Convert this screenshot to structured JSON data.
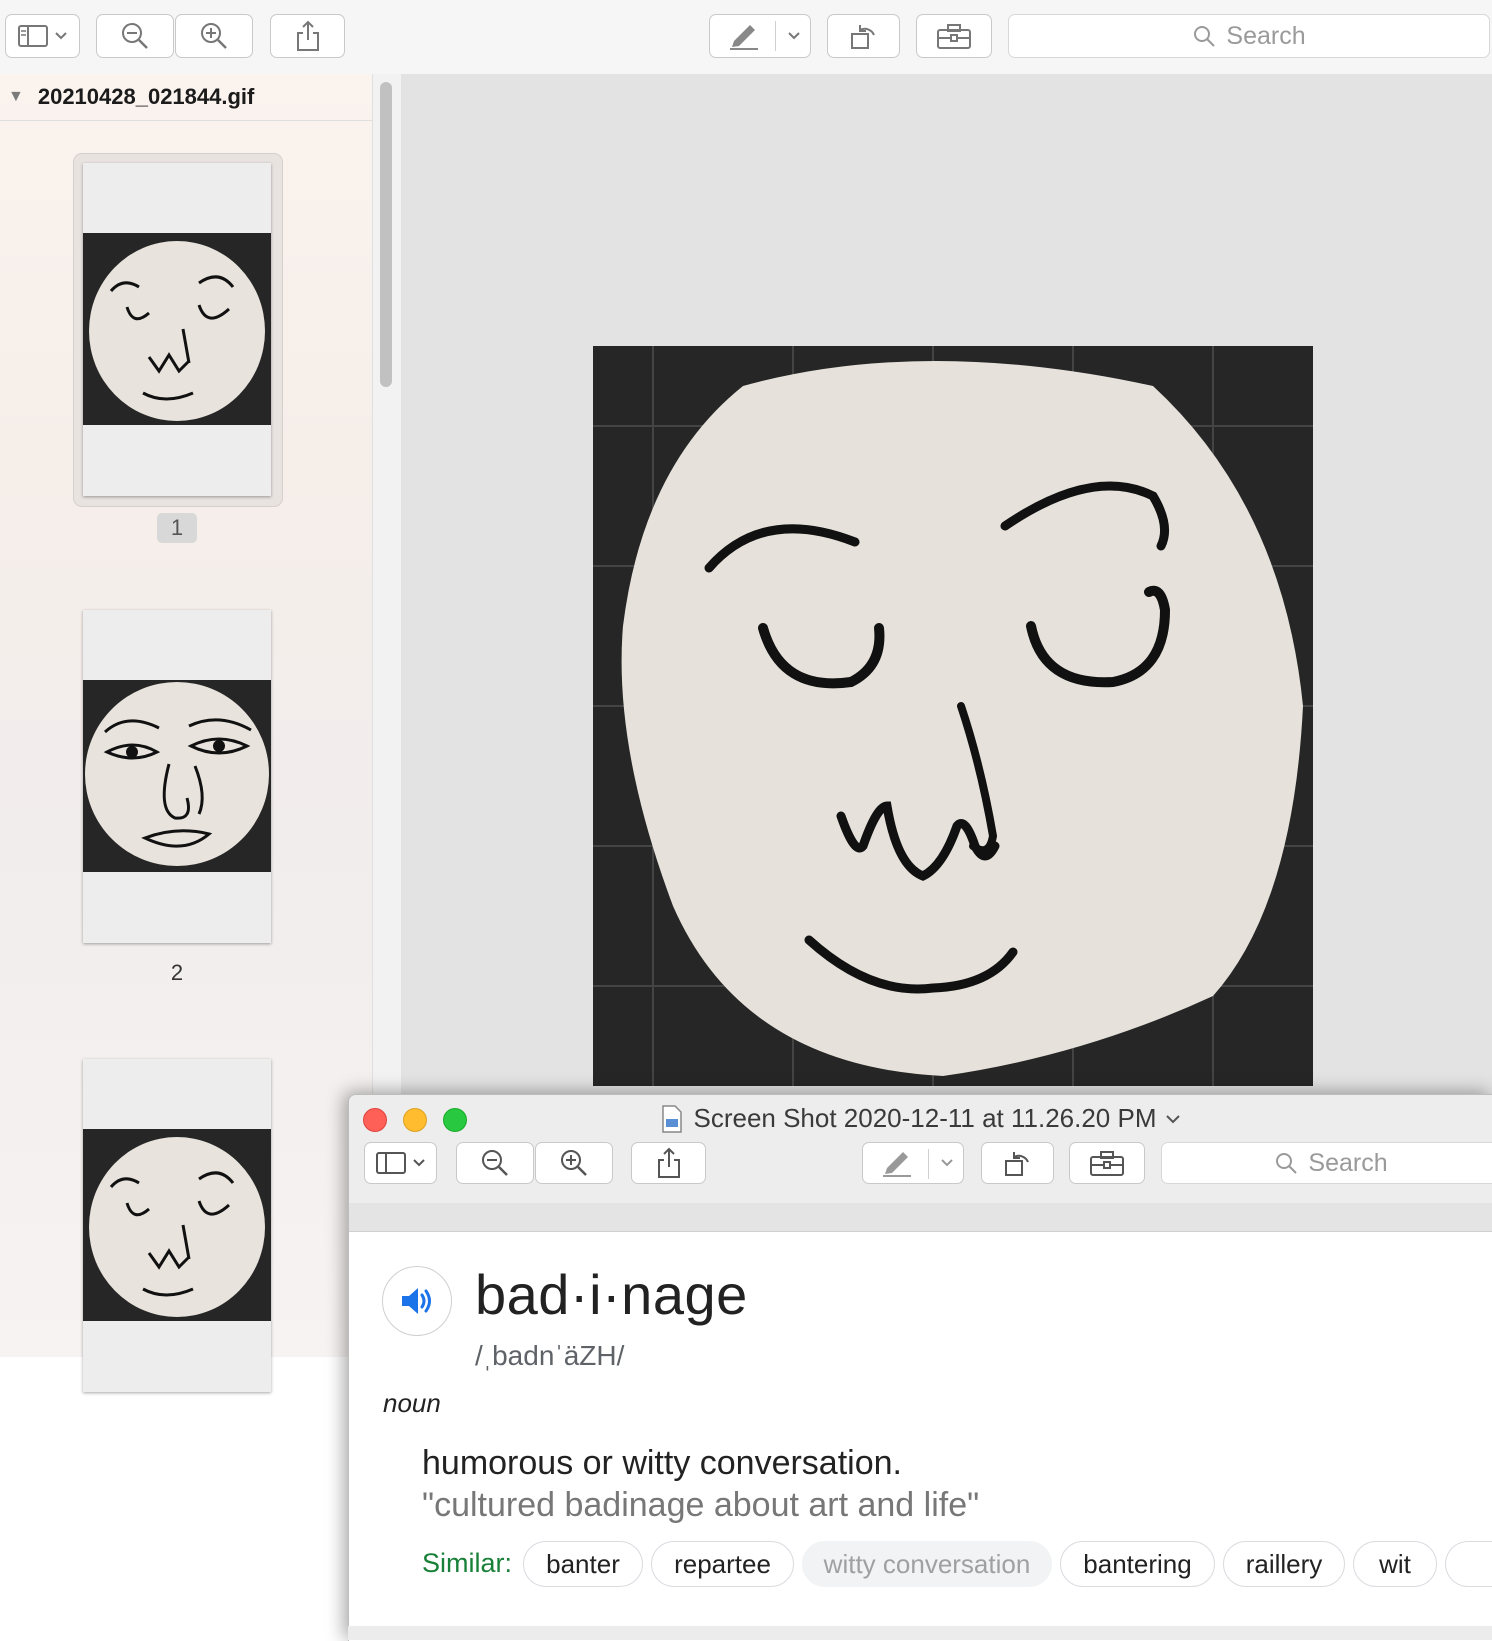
{
  "back_window": {
    "search_placeholder": "Search",
    "sidebar": {
      "file_name": "20210428_021844.gif",
      "pages": [
        {
          "label": "1",
          "selected": true
        },
        {
          "label": "2",
          "selected": false
        },
        {
          "label": "",
          "selected": false
        }
      ]
    },
    "toolbar_icons": [
      "sidebar-toggle-icon",
      "chevron-down-icon",
      "zoom-out-icon",
      "zoom-in-icon",
      "share-icon",
      "markup-pen-icon",
      "chevron-down-icon",
      "rotate-icon",
      "toolbox-icon",
      "search-icon"
    ]
  },
  "front_window": {
    "title": "Screen Shot 2020-12-11 at 11.26.20 PM",
    "search_placeholder": "Search",
    "traffic_lights": {
      "close": "#fe5f57",
      "minimize": "#febc2e",
      "zoom": "#28c840"
    },
    "dictionary": {
      "headword": "bad·i·nage",
      "pronunciation": "/ˌbadnˈäZH/",
      "part_of_speech": "noun",
      "definition": "humorous or witty conversation.",
      "example": "\"cultured badinage about art and life\"",
      "similar_label": "Similar:",
      "similar": [
        {
          "word": "banter",
          "muted": false
        },
        {
          "word": "repartee",
          "muted": false
        },
        {
          "word": "witty conversation",
          "muted": true
        },
        {
          "word": "bantering",
          "muted": false
        },
        {
          "word": "raillery",
          "muted": false
        },
        {
          "word": "wit",
          "muted": false
        }
      ]
    }
  },
  "colors": {
    "accent_blue": "#1a73e8",
    "similar_green": "#188038"
  }
}
